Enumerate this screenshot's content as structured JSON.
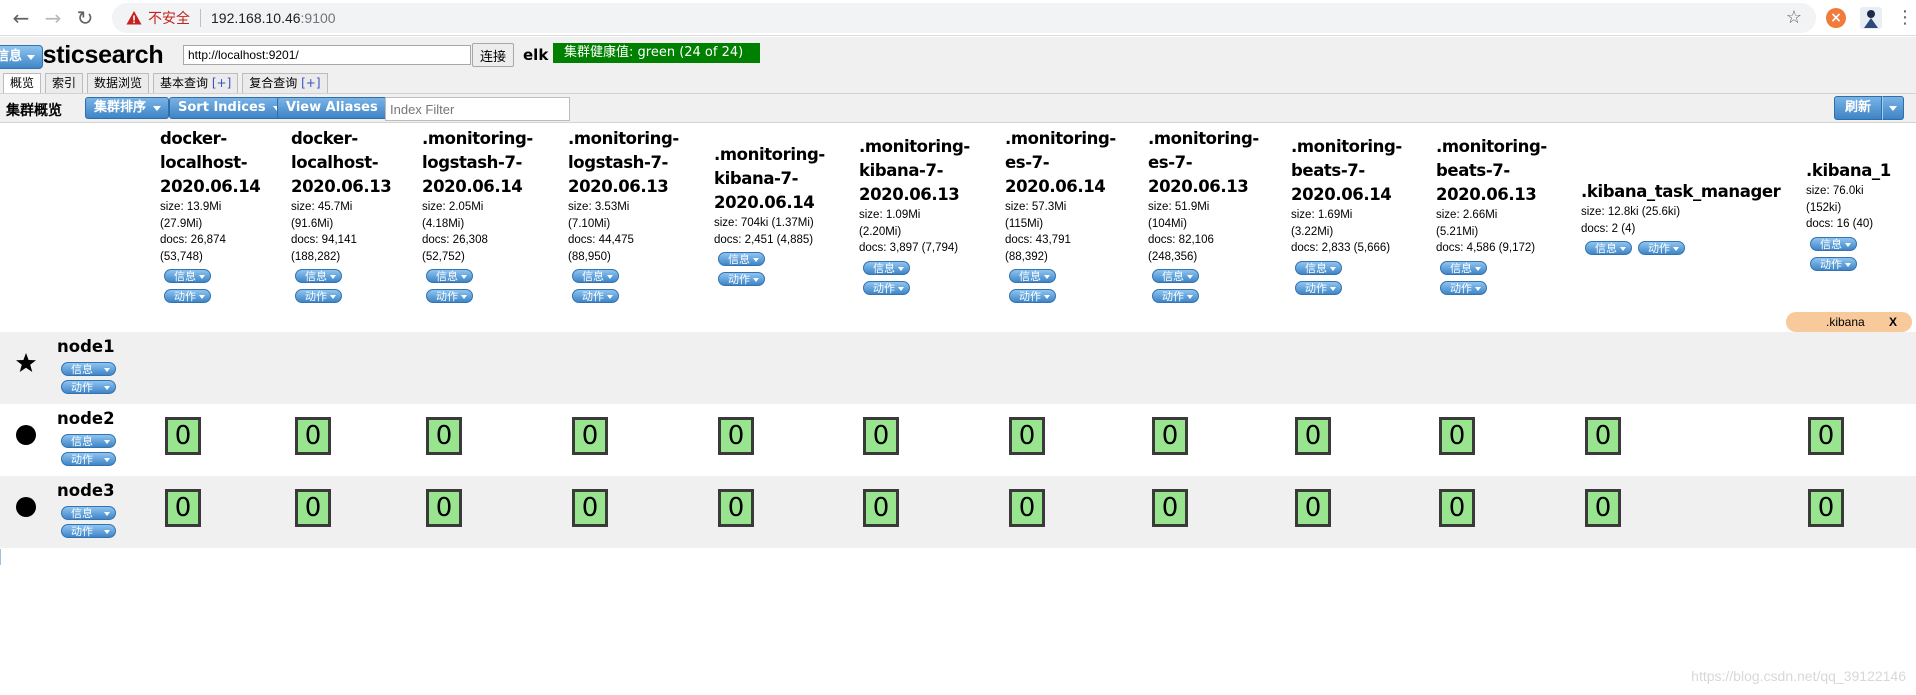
{
  "browser": {
    "security_label": "不安全",
    "url_host": "192.168.10.46",
    "url_port": ":9100",
    "extension_letter": "×"
  },
  "app": {
    "title": "Elasticsearch",
    "connect_url": "http://localhost:9201/",
    "connect_label": "连接",
    "cluster_name": "elk",
    "health_text": "集群健康值: green (24 of 24)",
    "health_color": "#008000",
    "info_label": "信息",
    "tabs": [
      {
        "label": "概览",
        "plus": ""
      },
      {
        "label": "索引",
        "plus": ""
      },
      {
        "label": "数据浏览",
        "plus": ""
      },
      {
        "label": "基本查询 ",
        "plus": "[+]"
      },
      {
        "label": "复合查询 ",
        "plus": "[+]"
      }
    ]
  },
  "toolbar": {
    "title": "集群概览",
    "sort_cluster": "集群排序",
    "sort_indices": "Sort Indices",
    "view_aliases": "View Aliases",
    "index_filter_placeholder": "Index Filter",
    "refresh": "刷新"
  },
  "buttons": {
    "info": "信息",
    "action": "动作"
  },
  "indices": [
    {
      "name_lines": [
        "docker-",
        "localhost-",
        "2020.06.14"
      ],
      "size": "size: 13.9Mi",
      "size2": "(27.9Mi)",
      "docs": "docs: 26,874",
      "docs2": "(53,748)"
    },
    {
      "name_lines": [
        "docker-",
        "localhost-",
        "2020.06.13"
      ],
      "size": "size: 45.7Mi",
      "size2": "(91.6Mi)",
      "docs": "docs: 94,141",
      "docs2": "(188,282)"
    },
    {
      "name_lines": [
        ".monitoring-",
        "logstash-7-",
        "2020.06.14"
      ],
      "size": "size: 2.05Mi",
      "size2": "(4.18Mi)",
      "docs": "docs: 26,308",
      "docs2": "(52,752)"
    },
    {
      "name_lines": [
        ".monitoring-",
        "logstash-7-",
        "2020.06.13"
      ],
      "size": "size: 3.53Mi",
      "size2": "(7.10Mi)",
      "docs": "docs: 44,475",
      "docs2": "(88,950)"
    },
    {
      "name_lines": [
        ".monitoring-",
        "kibana-7-",
        "2020.06.14"
      ],
      "size": "size: 704ki (1.37Mi)",
      "size2": "",
      "docs": "docs: 2,451 (4,885)",
      "docs2": ""
    },
    {
      "name_lines": [
        ".monitoring-",
        "kibana-7-",
        "2020.06.13"
      ],
      "size": "size: 1.09Mi",
      "size2": "(2.20Mi)",
      "docs": "docs: 3,897 (7,794)",
      "docs2": ""
    },
    {
      "name_lines": [
        ".monitoring-",
        "es-7-",
        "2020.06.14"
      ],
      "size": "size: 57.3Mi",
      "size2": "(115Mi)",
      "docs": "docs: 43,791",
      "docs2": "(88,392)"
    },
    {
      "name_lines": [
        ".monitoring-",
        "es-7-",
        "2020.06.13"
      ],
      "size": "size: 51.9Mi",
      "size2": "(104Mi)",
      "docs": "docs: 82,106",
      "docs2": "(248,356)"
    },
    {
      "name_lines": [
        ".monitoring-",
        "beats-7-",
        "2020.06.14"
      ],
      "size": "size: 1.69Mi",
      "size2": "(3.22Mi)",
      "docs": "docs: 2,833 (5,666)",
      "docs2": ""
    },
    {
      "name_lines": [
        ".monitoring-",
        "beats-7-",
        "2020.06.13"
      ],
      "size": "size: 2.66Mi",
      "size2": "(5.21Mi)",
      "docs": "docs: 4,586 (9,172)",
      "docs2": ""
    },
    {
      "name_lines": [
        ".kibana_task_manager"
      ],
      "size": "size: 12.8ki (25.6ki)",
      "size2": "",
      "docs": "docs: 2 (4)",
      "docs2": ""
    },
    {
      "name_lines": [
        ".kibana_1"
      ],
      "size": "size: 76.0ki",
      "size2": "(152ki)",
      "docs": "docs: 16 (40)",
      "docs2": ""
    }
  ],
  "alias": {
    "name": ".kibana",
    "close": "X"
  },
  "nodes": [
    {
      "name": "node1",
      "master": true,
      "shards": []
    },
    {
      "name": "node2",
      "master": false,
      "shards": [
        "0",
        "0",
        "0",
        "0",
        "0",
        "0",
        "0",
        "0",
        "0",
        "0",
        "0",
        "0"
      ]
    },
    {
      "name": "node3",
      "master": false,
      "shards": [
        "0",
        "0",
        "0",
        "0",
        "0",
        "0",
        "0",
        "0",
        "0",
        "0",
        "0",
        "0"
      ]
    }
  ],
  "watermark": "https://blog.csdn.net/qq_39122146"
}
